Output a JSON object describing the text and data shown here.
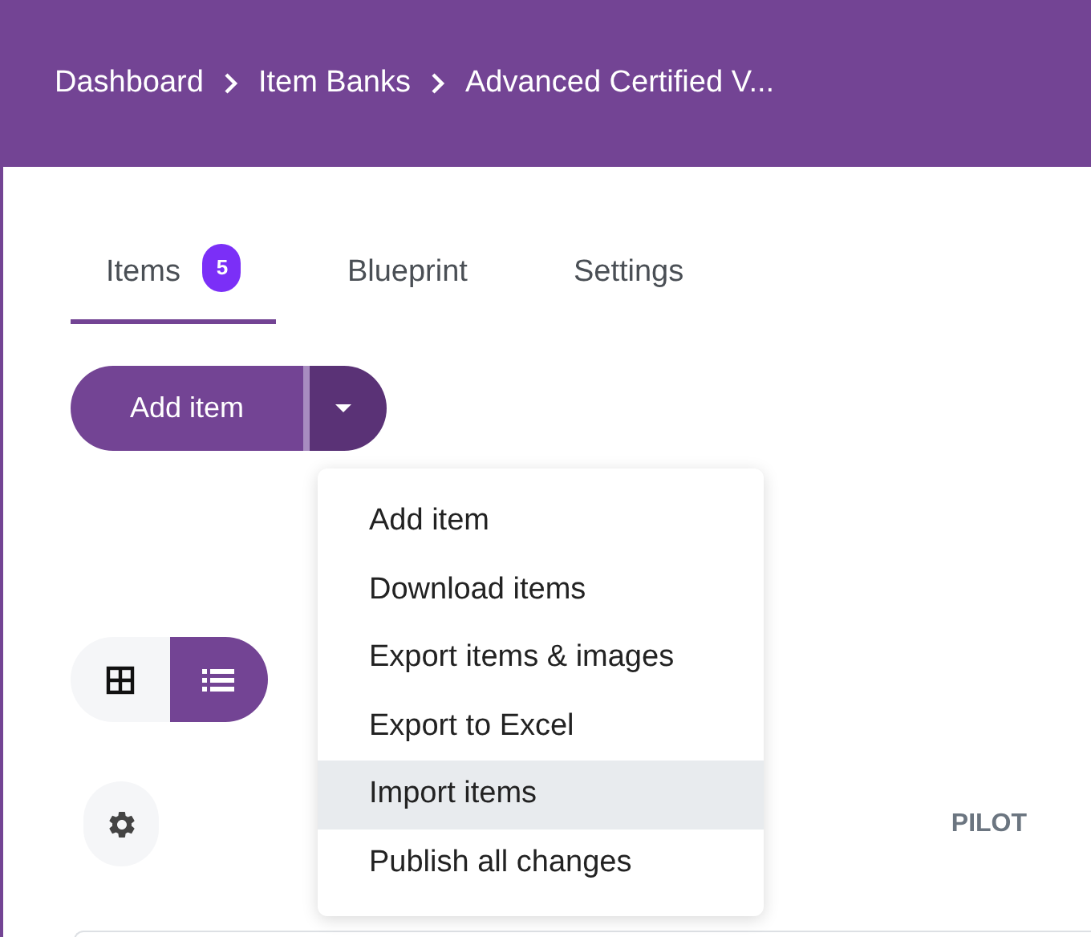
{
  "breadcrumb": [
    "Dashboard",
    "Item Banks",
    "Advanced Certified V..."
  ],
  "tabs": [
    {
      "label": "Items",
      "badge": "5",
      "selected": true
    },
    {
      "label": "Blueprint",
      "selected": false
    },
    {
      "label": "Settings",
      "selected": false
    }
  ],
  "add_button": {
    "label": "Add item"
  },
  "menu": [
    {
      "label": "Add item",
      "selected": false
    },
    {
      "label": "Download items",
      "selected": false
    },
    {
      "label": "Export items & images",
      "selected": false
    },
    {
      "label": "Export to Excel",
      "selected": false
    },
    {
      "label": "Import items",
      "selected": true
    },
    {
      "label": "Publish all changes",
      "selected": false
    }
  ],
  "view_toggle": [
    {
      "kind": "grid",
      "selected": false
    },
    {
      "kind": "list",
      "selected": true
    }
  ],
  "table": {
    "columns": [
      "PILOT"
    ]
  }
}
